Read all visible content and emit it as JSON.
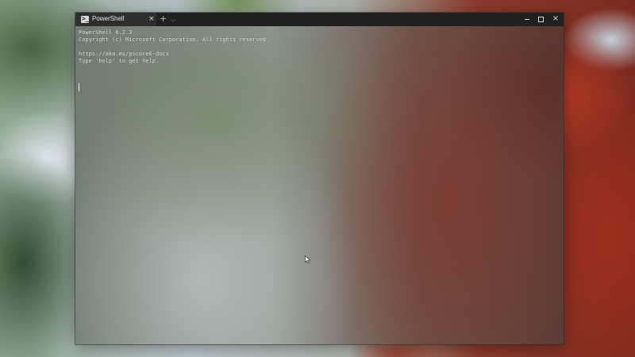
{
  "window": {
    "tab_label": "PowerShell",
    "tab_icon": "powershell-icon",
    "tab_close": "×",
    "new_tab": "+",
    "dropdown": "⌵"
  },
  "caption_buttons": {
    "minimize": "minimize-icon",
    "maximize": "maximize-icon",
    "close": "×"
  },
  "terminal": {
    "lines": [
      "PowerShell 6.2.3",
      "Copyright (c) Microsoft Corporation. All rights reserved.",
      "",
      "https://aka.ms/pscore6-docs",
      "Type 'help' to get help."
    ]
  },
  "colors": {
    "titlebar": "#202020",
    "tab_active": "#2e2e2e",
    "text": "#ececec"
  }
}
